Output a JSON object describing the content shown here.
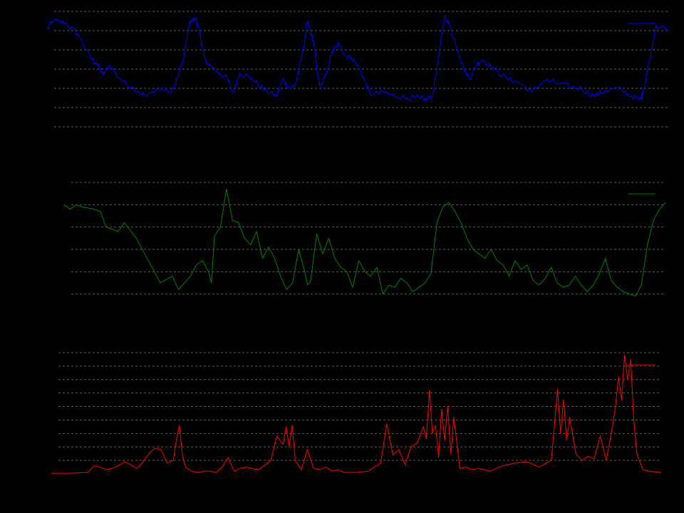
{
  "chart_data": [
    {
      "type": "line",
      "title": "",
      "xlabel": "",
      "ylabel": "",
      "grid": true,
      "grid_axis": "y",
      "legend": "top-right",
      "ylim": [
        0,
        7
      ],
      "yticks": [
        1,
        2,
        3,
        4,
        5,
        6,
        7
      ],
      "xlim": [
        0,
        1
      ],
      "series": [
        {
          "color": "#0000ff",
          "noise": 0.15,
          "x": [
            0,
            0.01,
            0.03,
            0.05,
            0.07,
            0.08,
            0.09,
            0.1,
            0.12,
            0.14,
            0.16,
            0.18,
            0.2,
            0.21,
            0.22,
            0.23,
            0.24,
            0.245,
            0.25,
            0.255,
            0.27,
            0.29,
            0.3,
            0.31,
            0.33,
            0.35,
            0.37,
            0.38,
            0.39,
            0.4,
            0.41,
            0.42,
            0.43,
            0.435,
            0.44,
            0.45,
            0.46,
            0.47,
            0.48,
            0.49,
            0.5,
            0.51,
            0.52,
            0.54,
            0.56,
            0.58,
            0.6,
            0.61,
            0.62,
            0.63,
            0.64,
            0.65,
            0.66,
            0.67,
            0.68,
            0.69,
            0.7,
            0.72,
            0.74,
            0.76,
            0.78,
            0.8,
            0.82,
            0.84,
            0.86,
            0.88,
            0.9,
            0.92,
            0.94,
            0.955,
            0.96,
            0.97,
            0.98,
            1.0
          ],
          "y": [
            6.1,
            6.5,
            6.4,
            5.8,
            4.6,
            4.3,
            3.7,
            4.2,
            3.4,
            3.0,
            2.6,
            3.0,
            2.8,
            3.5,
            4.6,
            6.5,
            6.6,
            6.0,
            5.1,
            4.4,
            4.0,
            3.5,
            2.8,
            3.8,
            3.5,
            2.9,
            2.6,
            3.5,
            3.0,
            3.2,
            4.7,
            6.5,
            5.2,
            3.8,
            3.0,
            3.8,
            5.0,
            5.3,
            4.7,
            4.6,
            4.2,
            3.5,
            2.7,
            2.8,
            2.6,
            2.5,
            2.5,
            2.4,
            2.6,
            4.5,
            6.8,
            6.1,
            5.1,
            4.1,
            3.5,
            4.2,
            4.5,
            4.0,
            3.5,
            3.3,
            2.8,
            3.4,
            3.3,
            3.1,
            3.0,
            2.6,
            2.9,
            3.0,
            2.6,
            2.4,
            2.9,
            4.5,
            6.3,
            6.0
          ]
        }
      ]
    },
    {
      "type": "line",
      "title": "",
      "xlabel": "",
      "ylabel": "",
      "grid": true,
      "grid_axis": "y",
      "legend": "top-right",
      "ylim": [
        0,
        6
      ],
      "yticks": [
        1,
        2,
        3,
        4,
        5,
        6
      ],
      "xlim": [
        0,
        1
      ],
      "series": [
        {
          "color": "#008000",
          "noise": 0.0,
          "x": [
            0,
            0.01,
            0.02,
            0.03,
            0.05,
            0.06,
            0.07,
            0.09,
            0.1,
            0.12,
            0.14,
            0.15,
            0.16,
            0.18,
            0.19,
            0.2,
            0.21,
            0.22,
            0.23,
            0.24,
            0.245,
            0.25,
            0.26,
            0.27,
            0.28,
            0.29,
            0.3,
            0.31,
            0.32,
            0.33,
            0.34,
            0.35,
            0.36,
            0.37,
            0.38,
            0.39,
            0.4,
            0.405,
            0.41,
            0.42,
            0.43,
            0.44,
            0.45,
            0.46,
            0.47,
            0.48,
            0.49,
            0.5,
            0.51,
            0.52,
            0.53,
            0.54,
            0.55,
            0.56,
            0.57,
            0.58,
            0.59,
            0.6,
            0.61,
            0.62,
            0.63,
            0.64,
            0.65,
            0.66,
            0.67,
            0.68,
            0.69,
            0.7,
            0.71,
            0.72,
            0.73,
            0.74,
            0.75,
            0.76,
            0.77,
            0.78,
            0.79,
            0.8,
            0.81,
            0.82,
            0.83,
            0.84,
            0.85,
            0.86,
            0.87,
            0.88,
            0.89,
            0.9,
            0.91,
            0.92,
            0.93,
            0.94,
            0.95,
            0.96,
            0.97,
            0.98,
            0.99,
            1.0
          ],
          "y": [
            5.0,
            4.8,
            5.0,
            4.9,
            4.8,
            4.7,
            4.0,
            3.8,
            4.2,
            3.5,
            2.5,
            2.0,
            1.5,
            1.8,
            1.2,
            1.5,
            1.8,
            2.3,
            2.5,
            2.0,
            1.5,
            3.6,
            4.0,
            5.7,
            4.3,
            4.2,
            3.5,
            3.2,
            3.8,
            2.6,
            3.1,
            2.6,
            1.8,
            1.2,
            1.5,
            3.0,
            2.0,
            1.4,
            1.6,
            3.7,
            2.8,
            3.5,
            2.6,
            2.2,
            2.0,
            1.3,
            2.5,
            2.0,
            1.8,
            2.2,
            1.0,
            1.4,
            1.3,
            1.7,
            1.5,
            1.1,
            1.3,
            1.5,
            1.9,
            4.2,
            4.9,
            5.1,
            4.7,
            4.2,
            3.5,
            3.0,
            2.8,
            2.6,
            3.0,
            2.5,
            2.3,
            1.8,
            2.5,
            2.1,
            2.3,
            1.6,
            1.4,
            1.7,
            2.2,
            1.5,
            1.3,
            1.4,
            1.8,
            1.4,
            1.1,
            1.4,
            1.9,
            2.6,
            1.6,
            1.3,
            1.1,
            1.0,
            0.9,
            1.4,
            3.2,
            4.3,
            4.8,
            5.1
          ]
        }
      ]
    },
    {
      "type": "line",
      "title": "",
      "xlabel": "",
      "ylabel": "",
      "grid": true,
      "grid_axis": "y",
      "legend": "top-right",
      "ylim": [
        0,
        9
      ],
      "yticks": [
        1,
        2,
        3,
        4,
        5,
        6,
        7,
        8,
        9
      ],
      "xlim": [
        0,
        1
      ],
      "series": [
        {
          "color": "#ff0000",
          "noise": 0.0,
          "x": [
            0,
            0.03,
            0.06,
            0.07,
            0.08,
            0.09,
            0.1,
            0.11,
            0.12,
            0.13,
            0.14,
            0.15,
            0.16,
            0.17,
            0.18,
            0.19,
            0.2,
            0.205,
            0.21,
            0.215,
            0.22,
            0.23,
            0.24,
            0.25,
            0.26,
            0.27,
            0.28,
            0.29,
            0.3,
            0.31,
            0.32,
            0.34,
            0.36,
            0.37,
            0.38,
            0.385,
            0.39,
            0.395,
            0.4,
            0.41,
            0.42,
            0.43,
            0.44,
            0.45,
            0.46,
            0.47,
            0.48,
            0.5,
            0.52,
            0.54,
            0.55,
            0.56,
            0.57,
            0.58,
            0.59,
            0.6,
            0.61,
            0.615,
            0.62,
            0.625,
            0.63,
            0.635,
            0.64,
            0.645,
            0.65,
            0.655,
            0.66,
            0.67,
            0.68,
            0.69,
            0.7,
            0.72,
            0.74,
            0.76,
            0.78,
            0.8,
            0.82,
            0.83,
            0.835,
            0.84,
            0.845,
            0.85,
            0.86,
            0.87,
            0.88,
            0.89,
            0.9,
            0.91,
            0.92,
            0.925,
            0.93,
            0.935,
            0.94,
            0.945,
            0.95,
            0.955,
            0.96,
            0.97,
            0.98,
            1.0
          ],
          "y": [
            0.05,
            0.05,
            0.1,
            0.6,
            0.5,
            0.3,
            0.4,
            0.6,
            0.9,
            0.7,
            0.4,
            0.9,
            1.5,
            1.9,
            1.8,
            0.8,
            1.0,
            2.5,
            3.6,
            1.4,
            0.5,
            0.2,
            0.1,
            0.2,
            0.2,
            0.1,
            0.5,
            1.2,
            0.2,
            0.4,
            0.5,
            0.3,
            1.0,
            2.8,
            2.2,
            3.5,
            2.0,
            3.6,
            1.0,
            0.3,
            1.8,
            0.4,
            0.3,
            0.5,
            0.2,
            0.3,
            0.1,
            0.1,
            0.2,
            0.8,
            3.7,
            1.4,
            1.8,
            0.7,
            2.0,
            2.3,
            3.5,
            2.6,
            6.2,
            3.0,
            3.6,
            1.2,
            4.8,
            2.5,
            5.0,
            1.5,
            4.2,
            0.4,
            0.5,
            0.3,
            0.4,
            0.2,
            0.6,
            0.8,
            0.9,
            0.5,
            1.0,
            6.3,
            3.0,
            5.5,
            2.5,
            4.2,
            1.5,
            1.0,
            1.3,
            1.1,
            2.8,
            1.0,
            3.5,
            5.0,
            7.2,
            5.5,
            8.8,
            7.0,
            8.5,
            4.0,
            1.5,
            0.3,
            0.2,
            0.1
          ]
        }
      ]
    }
  ]
}
